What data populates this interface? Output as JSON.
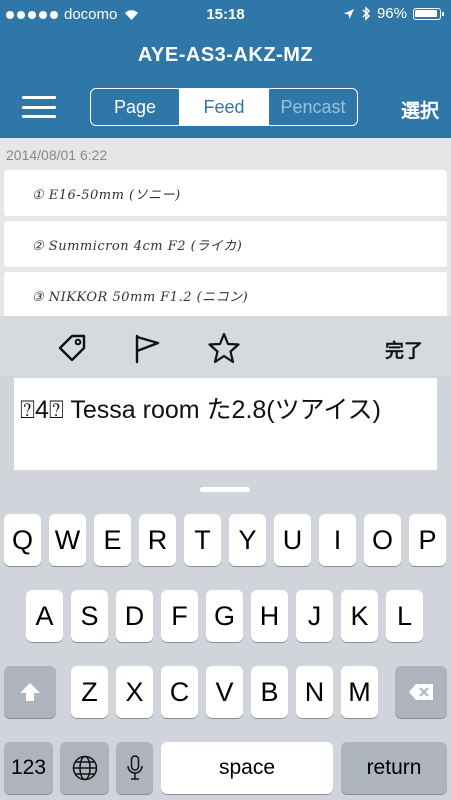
{
  "status_bar": {
    "carrier": "docomo",
    "time": "15:18",
    "battery": "96%"
  },
  "header": {
    "title": "AYE-AS3-AKZ-MZ",
    "tabs": [
      {
        "label": "Page"
      },
      {
        "label": "Feed"
      },
      {
        "label": "Pencast"
      }
    ],
    "active_tab": "Feed",
    "select_label": "選択"
  },
  "feed": {
    "date": "2014/08/01 6:22",
    "items": [
      {
        "text": "① E16-50mm (ソニー)"
      },
      {
        "text": "② Summicron 4cm F2 (ライカ)"
      },
      {
        "text": "③ NIKKOR 50mm F1.2 (ニコン)"
      }
    ]
  },
  "toolbar": {
    "icons": [
      "tag-icon",
      "flag-icon",
      "star-icon"
    ],
    "done_label": "完了"
  },
  "text_input": {
    "value": "⍰4⍰ Tessa room た2.8(ツアイス)"
  },
  "keyboard": {
    "row1": [
      "Q",
      "W",
      "E",
      "R",
      "T",
      "Y",
      "U",
      "I",
      "O",
      "P"
    ],
    "row2": [
      "A",
      "S",
      "D",
      "F",
      "G",
      "H",
      "J",
      "K",
      "L"
    ],
    "row3": [
      "Z",
      "X",
      "C",
      "V",
      "B",
      "N",
      "M"
    ],
    "numbers_label": "123",
    "space_label": "space",
    "return_label": "return"
  },
  "colors": {
    "header_bg": "#2f77a8",
    "keyboard_bg": "#d1d5db"
  }
}
